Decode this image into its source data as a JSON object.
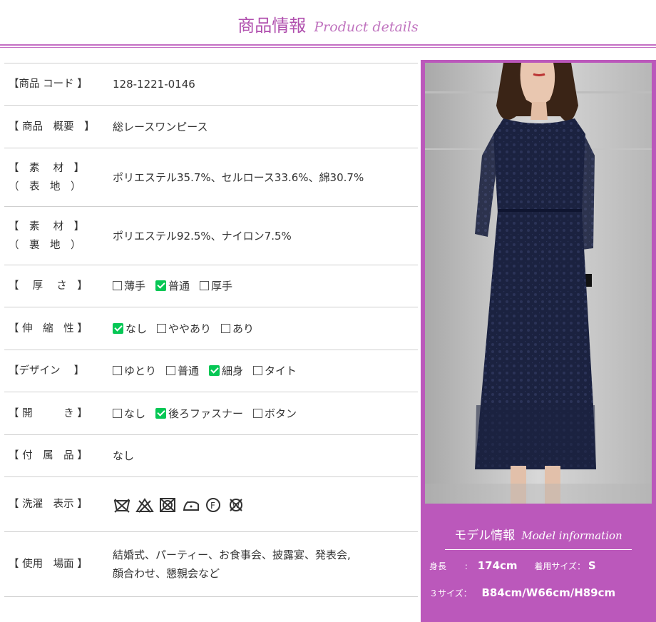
{
  "header": {
    "title_jp": "商品情報",
    "title_en": "Product details"
  },
  "rows": [
    {
      "label": "【商品 コード 】",
      "value": "128-1221-0146"
    },
    {
      "label": "【 商品　概要　】",
      "value": "総レースワンピース"
    },
    {
      "label": "【　素　 材　】\n（　表　地　）",
      "value": "ポリエステル35.7%、セルロース33.6%、綿30.7%"
    },
    {
      "label": "【　素　 材　】\n（　裏　地　）",
      "value": "ポリエステル92.5%、ナイロン7.5%"
    },
    {
      "label": "【　 厚　 さ　】",
      "options": [
        {
          "text": "薄手",
          "checked": false
        },
        {
          "text": "普通",
          "checked": true
        },
        {
          "text": "厚手",
          "checked": false
        }
      ]
    },
    {
      "label": "【 伸　縮　性 】",
      "options": [
        {
          "text": "なし",
          "checked": true
        },
        {
          "text": "ややあり",
          "checked": false
        },
        {
          "text": "あり",
          "checked": false
        }
      ]
    },
    {
      "label": "【デザイン　 】",
      "options": [
        {
          "text": "ゆとり",
          "checked": false
        },
        {
          "text": "普通",
          "checked": false
        },
        {
          "text": "細身",
          "checked": true
        },
        {
          "text": "タイト",
          "checked": false
        }
      ]
    },
    {
      "label": "【 開　　　き 】",
      "options": [
        {
          "text": "なし",
          "checked": false
        },
        {
          "text": "後ろファスナー",
          "checked": true
        },
        {
          "text": "ボタン",
          "checked": false
        }
      ]
    },
    {
      "label": "【 付　属　品 】",
      "value": "なし"
    },
    {
      "label": "【 洗濯　表示 】",
      "care_icons": [
        "no-washing-icon",
        "no-bleach-icon",
        "no-tumble-dry-icon",
        "low-iron-icon",
        "dry-clean-f-icon",
        "no-wet-clean-icon"
      ]
    },
    {
      "label": "【 使用　場面 】",
      "value": "結婚式、パーティー、お食事会、披露宴、発表会,\n顔合わせ、懇親会など"
    }
  ],
  "model": {
    "title_jp": "モデル情報",
    "title_en": "Model information",
    "height_label": "身長",
    "height_value": "174cm",
    "size_label": "着用サイズ：",
    "size_value": "S",
    "measure_label": "３サイズ：",
    "measure_value": "B84cm/W66cm/H89cm"
  },
  "colors": {
    "accent": "#bb58bb",
    "check": "#06c755",
    "dress": "#1b2240"
  }
}
